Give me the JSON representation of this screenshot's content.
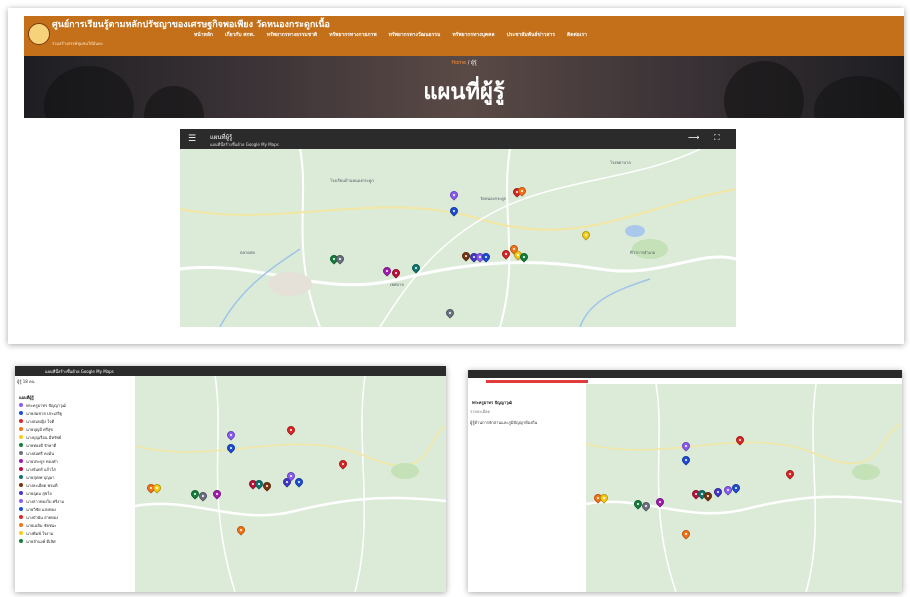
{
  "site": {
    "name": "ศูนย์การเรียนรู้ตามหลักปรัชญาของเศรษฐกิจพอเพียง วัดหนองกระดูกเนื้อ",
    "subtitle": "ร่วมสร้างสรรค์ชุมชนให้มั่นคง",
    "nav": [
      "หน้าหลัก",
      "เกี่ยวกับ ศกพ.",
      "ทรัพยากรทางธรรมชาติ",
      "ทรัพยากรทางกายภาพ",
      "ทรัพยากรทางวัฒนธรรม",
      "ทรัพยากรทางบุคคล",
      "ประชาสัมพันธ์ข่าวสาร",
      "ติดต่อเรา"
    ]
  },
  "hero": {
    "breadcrumb_home": "Home",
    "breadcrumb_sep": "/",
    "breadcrumb_current": "ผู้รู้",
    "title": "แผนที่ผู้รู้"
  },
  "embed": {
    "title": "แผนที่ผู้รู้",
    "subtitle": "แผนที่นี้สร้างขึ้นด้วย Google My Maps",
    "menu_icon": "menu-icon",
    "share_icon": "share-icon",
    "fullscreen_icon": "fullscreen-icon"
  },
  "map_labels": [
    "โรงเรียนบ้านหนองกระดูก",
    "วัดหนองกระดูก",
    "โรงพยาบาล",
    "ตลาดสด",
    "เทศบาล",
    "ที่ว่าการอำเภอ"
  ],
  "left_panel": {
    "header": "แผนที่นี้สร้างขึ้นด้วย Google My Maps",
    "info": "ผู้รู้ 18 คน",
    "layer_title": "แผนที่ผู้รู้",
    "items": [
      "พระครูอาทร ปัญญาวุฒิ",
      "นายสมชาย ประเสริฐ",
      "นางสมหญิง ใจดี",
      "นายบุญมี ศรีสุข",
      "นางบุญเรือน มีทรัพย์",
      "นายทองดี รักษาดี",
      "นางสมศรี คงมั่น",
      "นายประยูร ทองคำ",
      "นางจันทร์ แก้วใส",
      "นายสุเทพ บุญมา",
      "นางละเอียด พรมดี",
      "นายอุดม สุขใจ",
      "นางสาวทองใบ ศรีงาม",
      "นายวิชัย แสงทอง",
      "นางบัวผัน สายทอง",
      "นายเฉลิม ชัยชนะ",
      "นางพิมพ์ ใจงาม",
      "นายจำนงค์ ดีเลิศ"
    ]
  },
  "right_panel": {
    "item_title": "พระครูอาทร ปัญญาวุฒิ",
    "desc_label": "รายละเอียด",
    "desc_text": "ผู้รู้ด้านการจักสานและภูมิปัญญาท้องถิ่น"
  },
  "colors": {
    "header_orange": "#c4701a",
    "map_bg": "#dcebd8",
    "pins": [
      "#8b5cf6",
      "#1d4ed8",
      "#dc2626",
      "#f97316",
      "#facc15",
      "#15803d",
      "#6b7280",
      "#a21caf",
      "#be123c",
      "#0f766e",
      "#78350f",
      "#4338ca"
    ]
  }
}
